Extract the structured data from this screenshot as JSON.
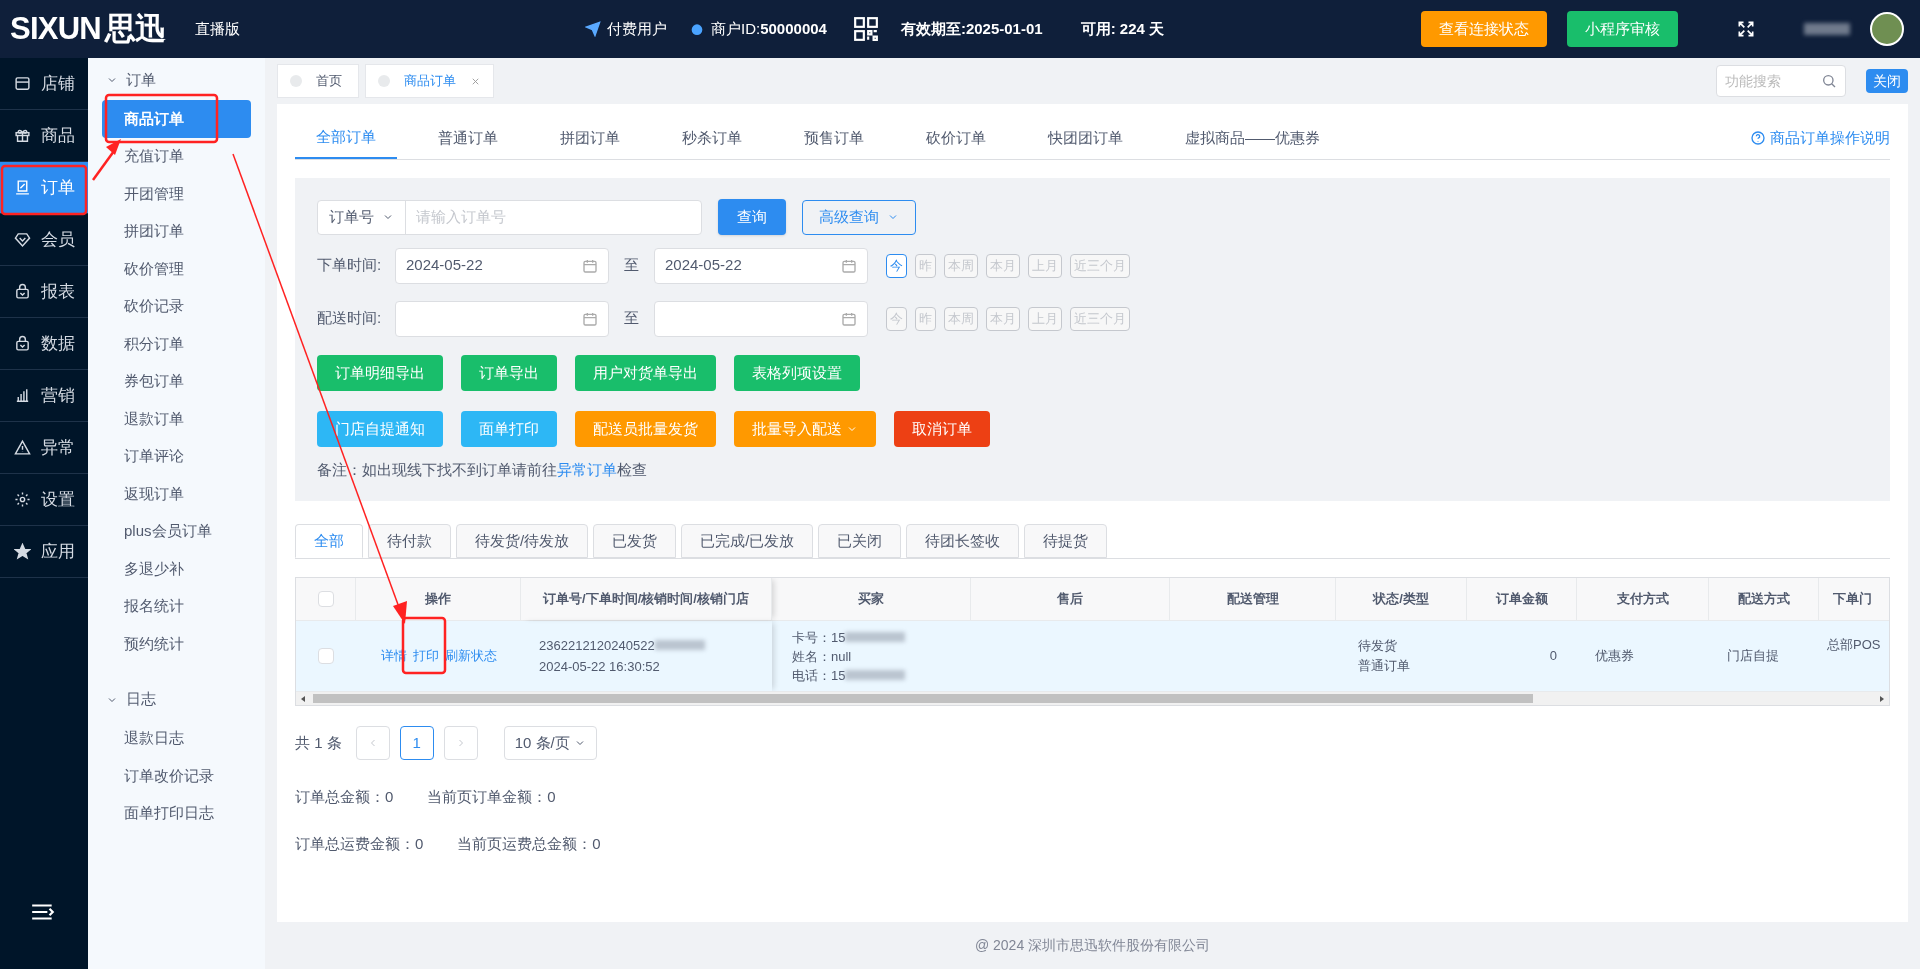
{
  "header": {
    "logo": "SIXUN",
    "logo_cn": "思迅",
    "edition": "直播版",
    "user_type": "付费用户",
    "merchant_label": "商户ID:",
    "merchant_id": "50000004",
    "expiry": "有效期至:2025-01-01",
    "remaining": "可用: 224 天",
    "buttons": [
      {
        "label": "查看连接状态",
        "color": "#ff9900"
      },
      {
        "label": "小程序审核",
        "color": "#19be6b"
      }
    ]
  },
  "nav": [
    {
      "label": "店铺",
      "selected": false
    },
    {
      "label": "商品",
      "selected": false
    },
    {
      "label": "订单",
      "selected": true
    },
    {
      "label": "会员",
      "selected": false
    },
    {
      "label": "报表",
      "selected": false
    },
    {
      "label": "数据",
      "selected": false
    },
    {
      "label": "营销",
      "selected": false
    },
    {
      "label": "异常",
      "selected": false
    },
    {
      "label": "设置",
      "selected": false
    },
    {
      "label": "应用",
      "selected": false
    }
  ],
  "submenu": [
    {
      "label": "订单",
      "expanded": true,
      "items": [
        {
          "label": "商品订单",
          "selected": true
        },
        {
          "label": "充值订单",
          "selected": false
        },
        {
          "label": "开团管理",
          "selected": false
        },
        {
          "label": "拼团订单",
          "selected": false
        },
        {
          "label": "砍价管理",
          "selected": false
        },
        {
          "label": "砍价记录",
          "selected": false
        },
        {
          "label": "积分订单",
          "selected": false
        },
        {
          "label": "券包订单",
          "selected": false
        },
        {
          "label": "退款订单",
          "selected": false
        },
        {
          "label": "订单评论",
          "selected": false
        },
        {
          "label": "返现订单",
          "selected": false
        },
        {
          "label": "plus会员订单",
          "selected": false
        },
        {
          "label": "多退少补",
          "selected": false
        },
        {
          "label": "报名统计",
          "selected": false
        },
        {
          "label": "预约统计",
          "selected": false
        }
      ]
    },
    {
      "label": "日志",
      "expanded": true,
      "items": [
        {
          "label": "退款日志",
          "selected": false
        },
        {
          "label": "订单改价记录",
          "selected": false
        },
        {
          "label": "面单打印日志",
          "selected": false
        }
      ]
    }
  ],
  "page_tabs": [
    {
      "label": "首页",
      "selected": false,
      "closable": false
    },
    {
      "label": "商品订单",
      "selected": true,
      "closable": true
    }
  ],
  "function_search": {
    "placeholder": "功能搜索"
  },
  "close_button": "关闭",
  "order_tabs": [
    {
      "label": "全部订单",
      "selected": true
    },
    {
      "label": "普通订单",
      "selected": false
    },
    {
      "label": "拼团订单",
      "selected": false
    },
    {
      "label": "秒杀订单",
      "selected": false
    },
    {
      "label": "预售订单",
      "selected": false
    },
    {
      "label": "砍价订单",
      "selected": false
    },
    {
      "label": "快团团订单",
      "selected": false
    },
    {
      "label": "虚拟商品——优惠券",
      "selected": false
    }
  ],
  "help_link": "商品订单操作说明",
  "filter": {
    "search_type": "订单号",
    "search_placeholder": "请输入订单号",
    "query_button": "查询",
    "advanced_button": "高级查询",
    "date_rows": [
      {
        "label": "下单时间:",
        "from": "2024-05-22",
        "to": "2024-05-22",
        "separator": "至",
        "quick": [
          {
            "label": "今",
            "selected": true
          },
          {
            "label": "昨",
            "selected": false
          },
          {
            "label": "本周",
            "selected": false
          },
          {
            "label": "本月",
            "selected": false
          },
          {
            "label": "上月",
            "selected": false
          },
          {
            "label": "近三个月",
            "selected": false
          }
        ]
      },
      {
        "label": "配送时间:",
        "separator": "至",
        "quick": [
          {
            "label": "今",
            "selected": false
          },
          {
            "label": "昨",
            "selected": false
          },
          {
            "label": "本周",
            "selected": false
          },
          {
            "label": "本月",
            "selected": false
          },
          {
            "label": "上月",
            "selected": false
          },
          {
            "label": "近三个月",
            "selected": false
          }
        ]
      }
    ],
    "action_rows": [
      [
        {
          "label": "订单明细导出",
          "color": "#19be6b"
        },
        {
          "label": "订单导出",
          "color": "#19be6b"
        },
        {
          "label": "用户对货单导出",
          "color": "#19be6b"
        },
        {
          "label": "表格列项设置",
          "color": "#19be6b"
        }
      ],
      [
        {
          "label": "门店自提通知",
          "color": "#2db7f5"
        },
        {
          "label": "面单打印",
          "color": "#2db7f5"
        },
        {
          "label": "配送员批量发货",
          "color": "#ff9900"
        },
        {
          "label": "批量导入配送",
          "color": "#ff9900",
          "dropdown": true
        },
        {
          "label": "取消订单",
          "color": "#ed4014"
        }
      ]
    ],
    "note": "备注：如出现线下找不到订单请前往 ",
    "note_link": "异常订单",
    "note_end": "检查"
  },
  "status_tabs": [
    {
      "label": "全部",
      "selected": true
    },
    {
      "label": "待付款",
      "selected": false
    },
    {
      "label": "待发货/待发放",
      "selected": false
    },
    {
      "label": "已发货",
      "selected": false
    },
    {
      "label": "已完成/已发放",
      "selected": false
    },
    {
      "label": "已关闭",
      "selected": false
    },
    {
      "label": "待团长签收",
      "selected": false
    },
    {
      "label": "待提货",
      "selected": false
    }
  ],
  "table": {
    "header_checked": false,
    "columns": [
      "操作",
      "订单号/下单时间/核销时间/核销门店",
      "买家",
      "售后",
      "配送管理",
      "状态/类型",
      "订单金额",
      "支付方式",
      "配送方式",
      "下单门"
    ],
    "rows": [
      {
        "checked": false,
        "actions": [
          "详情",
          "打印",
          "刷新状态"
        ],
        "order_no": "2362212120240522",
        "order_time": "2024-05-22 16:30:52",
        "buyer": [
          "卡号：15",
          "姓名：null",
          "电话：15"
        ],
        "status": [
          "待发货",
          "普通订单"
        ],
        "amount": "0",
        "payment": "优惠券",
        "delivery": "门店自提",
        "store": "总部POS"
      }
    ]
  },
  "pagination": {
    "total": "共 1 条",
    "pages": [
      {
        "label": "1",
        "selected": true
      }
    ],
    "page_size": "10 条/页"
  },
  "totals": [
    [
      "订单总金额：0",
      "当前页订单金额：0"
    ],
    [
      "订单总运费金额：0",
      "当前页运费总金额：0"
    ]
  ],
  "footer": "@ 2024 深圳市思迅软件股份有限公司"
}
